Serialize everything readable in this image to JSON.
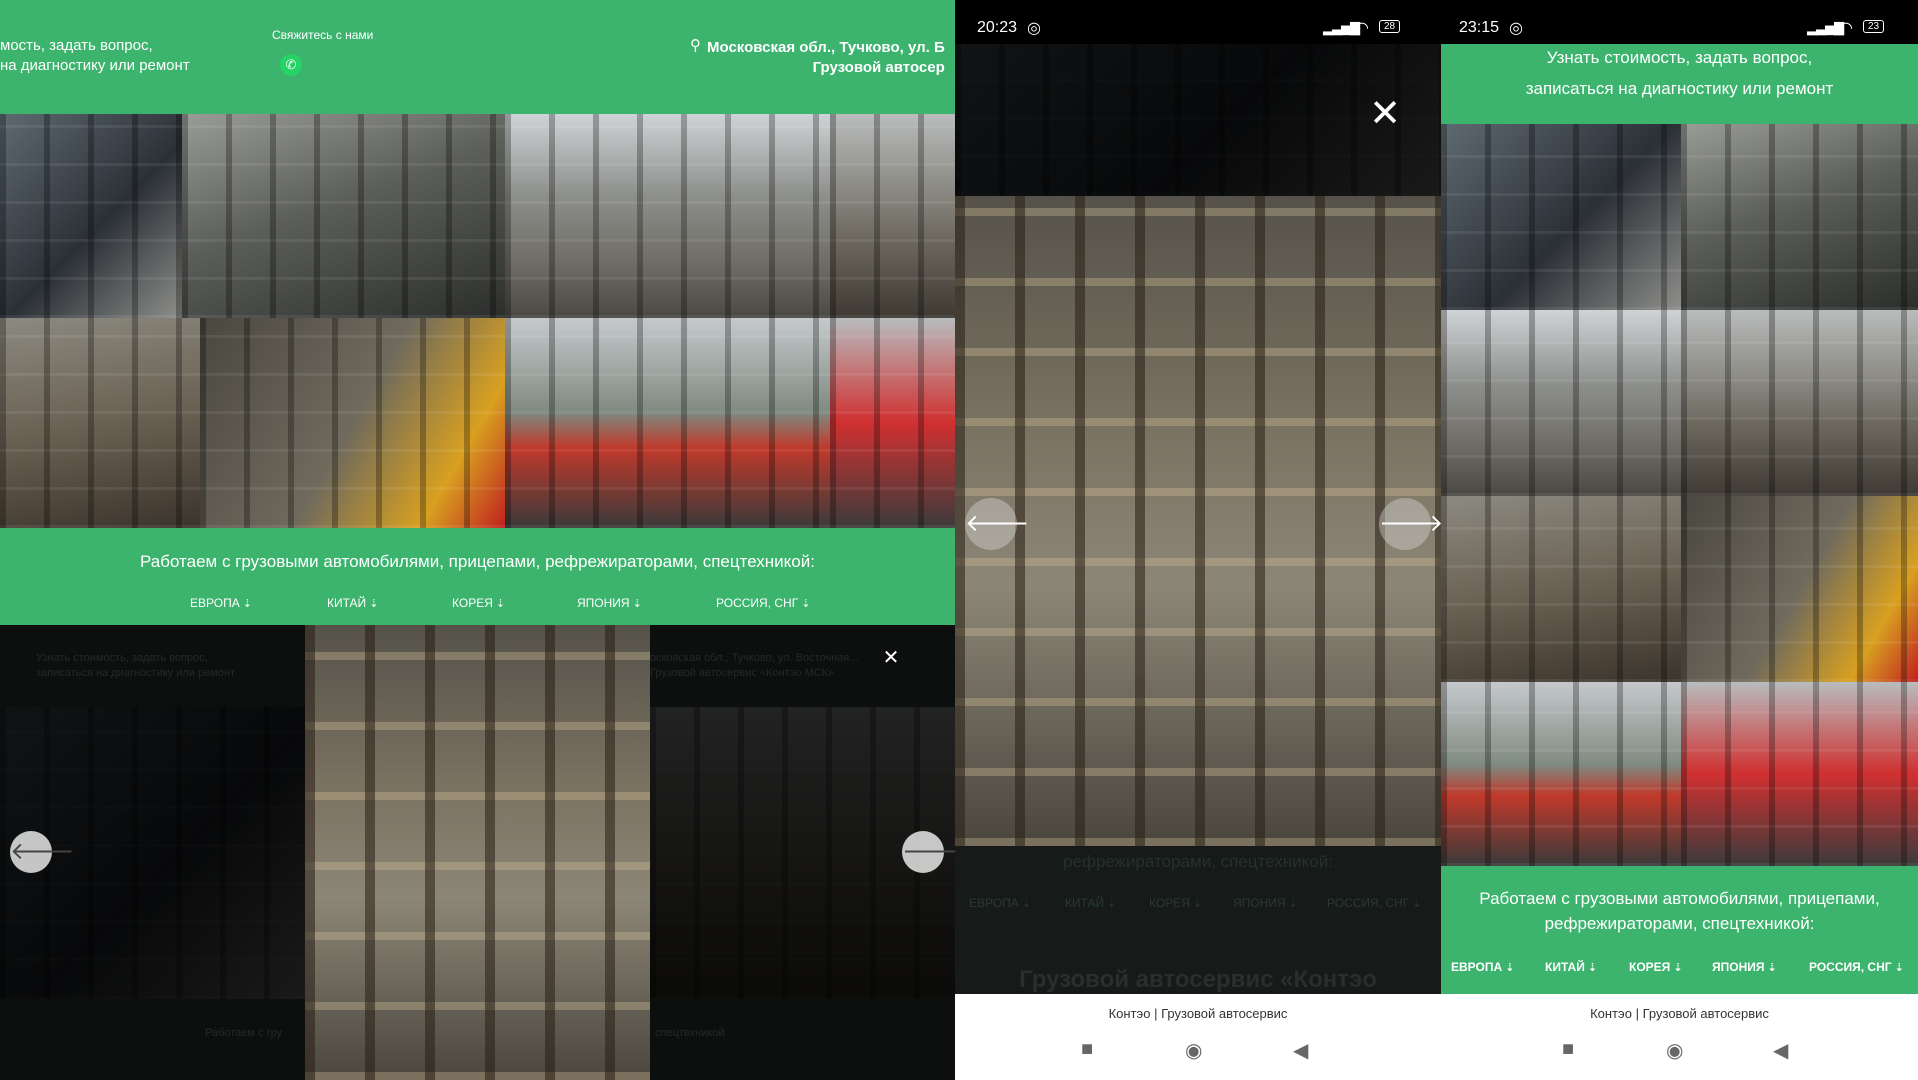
{
  "panel1": {
    "header_cta": "мость, задать вопрос,\nна диагностику или ремонт",
    "contact_label": "Свяжитесь с нами",
    "address": "Московская обл., Тучково, ул. Б\nГрузовой автосер",
    "banner_text": "Работаем с грузовыми автомобилями, прицепами, рефрежираторами, спецтехникой:",
    "categories": [
      "ЕВРОПА",
      "КИТАЙ",
      "КОРЕЯ",
      "ЯПОНИЯ",
      "РОССИЯ, СНГ"
    ],
    "lightbox": {
      "close": "✕",
      "prev": "🡐",
      "next": "🡒",
      "bg_text_left": "Узнать стоимость, задать вопрос,\nзаписаться на диагностику или ремонт",
      "bg_text_right": "осковская обл., Тучково, ул. Восточная...\nГрузовой автосервис «Контэо МСК»",
      "bg_footer_left": "Работаем с гру",
      "bg_footer_right": "спецтехникой"
    }
  },
  "panel2": {
    "time": "20:23",
    "battery": "28",
    "close": "✕",
    "prev": "🡐",
    "next": "🡒",
    "bg_subtitle": "рефрежираторами, спецтехникой:",
    "bg_categories": [
      "ЕВРОПА",
      "КИТАЙ",
      "КОРЕЯ",
      "ЯПОНИЯ",
      "РОССИЯ, СНГ"
    ],
    "bg_heading": "Грузовой автосервис «Контэо",
    "page_title": "Контэо | Грузовой автосервис"
  },
  "panel3": {
    "time": "23:15",
    "battery": "23",
    "header_cta": "Узнать стоимость, задать вопрос,\nзаписаться на диагностику или ремонт",
    "banner_text": "Работаем с грузовыми автомобилями, прицепами,\nрефрежираторами, спецтехникой:",
    "categories": [
      "ЕВРОПА",
      "КИТАЙ",
      "КОРЕЯ",
      "ЯПОНИЯ",
      "РОССИЯ, СНГ"
    ],
    "page_title": "Контэо | Грузовой автосервис"
  },
  "colors": {
    "brand_green": "#3cb46e",
    "whatsapp": "#25d366"
  },
  "icons": [
    "location-pin-icon",
    "whatsapp-icon",
    "close-icon",
    "arrow-left-icon",
    "arrow-right-icon",
    "wifi-icon",
    "signal-icon",
    "battery-icon",
    "sync-icon",
    "nav-square-icon",
    "nav-circle-icon",
    "nav-back-icon"
  ]
}
